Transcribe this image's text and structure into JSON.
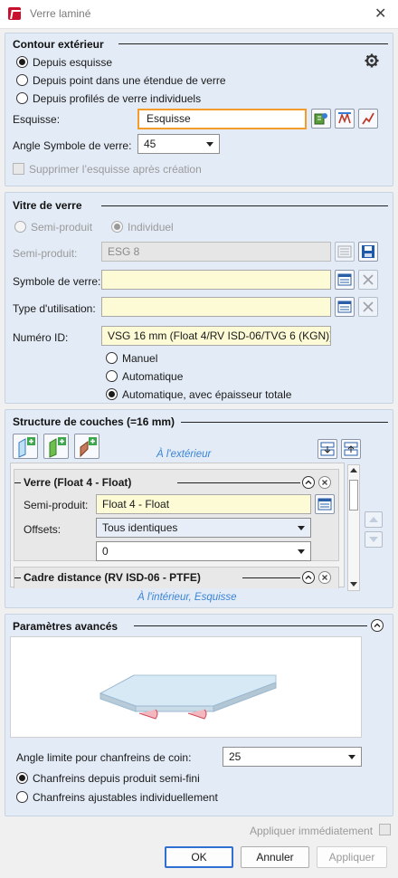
{
  "window": {
    "title": "Verre laminé"
  },
  "contour": {
    "heading": "Contour extérieur",
    "options": [
      "Depuis esquisse",
      "Depuis point dans une étendue de verre",
      "Depuis profilés de verre individuels"
    ],
    "sketch_label": "Esquisse:",
    "sketch_value": "Esquisse",
    "angle_label": "Angle Symbole de verre:",
    "angle_value": "45",
    "delete_sketch_label": "Supprimer l’esquisse après création"
  },
  "pane": {
    "heading": "Vitre de verre",
    "semi_option": "Semi-produit",
    "individual_option": "Individuel",
    "semi_label": "Semi-produit:",
    "semi_value": "ESG 8",
    "symbol_label": "Symbole de verre:",
    "symbol_value": "",
    "usage_label": "Type d'utilisation:",
    "usage_value": "",
    "number_label": "Numéro ID:",
    "number_value": "VSG 16 mm (Float 4/RV ISD-06/TVG 6 (KGN))",
    "mode_options": [
      "Manuel",
      "Automatique",
      "Automatique, avec épaisseur totale"
    ]
  },
  "layers": {
    "heading": "Structure de couches (=16 mm)",
    "outside_label": "À l'extérieur",
    "inside_label": "À l'intérieur, Esquisse",
    "layer1_title": "Verre (Float 4 - Float)",
    "layer1_semi_label": "Semi-produit:",
    "layer1_semi_value": "Float 4 - Float",
    "layer1_offsets_label": "Offsets:",
    "layer1_offsets_value": "Tous identiques",
    "layer1_offset_num": "0",
    "layer2_title": "Cadre distance (RV ISD-06 - PTFE)"
  },
  "advanced": {
    "heading": "Paramètres avancés",
    "angle_label": "Angle limite pour chanfreins de coin:",
    "angle_value": "25",
    "chamfer_options": [
      "Chanfreins depuis produit semi-fini",
      "Chanfreins ajustables individuellement"
    ]
  },
  "footer": {
    "apply_immediately": "Appliquer immédiatement",
    "ok": "OK",
    "cancel": "Annuler",
    "apply": "Appliquer"
  }
}
